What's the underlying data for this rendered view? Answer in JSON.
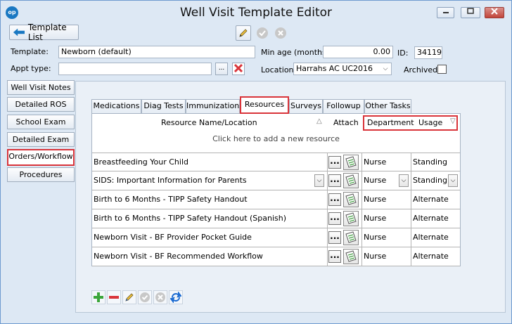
{
  "window": {
    "title": "Well Visit Template Editor",
    "logo_text": "op",
    "controls": [
      "minimize",
      "maximize",
      "close"
    ]
  },
  "toolbar": {
    "template_list_label": "Template List",
    "icons": [
      "edit-icon",
      "accept-icon",
      "cancel-icon"
    ]
  },
  "header": {
    "template_label": "Template:",
    "template_value": "Newborn (default)",
    "appt_type_label": "Appt type:",
    "appt_type_value": "",
    "browse_label": "...",
    "min_age_label": "Min age (months):",
    "min_age_value": "0.00",
    "id_label": "ID:",
    "id_value": "34119",
    "location_label": "Location:",
    "location_value": "Harrahs AC UC2016",
    "archived_label": "Archived:",
    "archived_checked": false
  },
  "sidebar": {
    "items": [
      {
        "label": "Well Visit Notes",
        "active": false
      },
      {
        "label": "Detailed ROS",
        "active": false
      },
      {
        "label": "School Exam",
        "active": false
      },
      {
        "label": "Detailed Exam",
        "active": false
      },
      {
        "label": "Orders/Workflow",
        "active": true
      },
      {
        "label": "Procedures",
        "active": false
      }
    ]
  },
  "tabs": [
    {
      "label": "Medications"
    },
    {
      "label": "Diag Tests"
    },
    {
      "label": "Immunizations"
    },
    {
      "label": "Resources",
      "active": true
    },
    {
      "label": "Surveys"
    },
    {
      "label": "Followup"
    },
    {
      "label": "Other Tasks"
    }
  ],
  "grid": {
    "columns": {
      "name": "Resource Name/Location",
      "attach": "Attach",
      "department": "Department",
      "usage": "Usage"
    },
    "add_row_text": "Click here to add a new resource",
    "more_button": "...",
    "rows": [
      {
        "name": "Breastfeeding Your Child",
        "department": "Nurse",
        "usage": "Standing"
      },
      {
        "name": "SIDS: Important Information for Parents",
        "department": "Nurse",
        "usage": "Standing"
      },
      {
        "name": "Birth to 6 Months - TIPP Safety Handout",
        "department": "Nurse",
        "usage": "Alternate"
      },
      {
        "name": "Birth to 6 Months - TIPP Safety Handout (Spanish)",
        "department": "Nurse",
        "usage": "Alternate"
      },
      {
        "name": "Newborn Visit - BF Provider Pocket Guide",
        "department": "Nurse",
        "usage": "Alternate"
      },
      {
        "name": "Newborn Visit - BF Recommended Workflow",
        "department": "Nurse",
        "usage": "Alternate"
      }
    ]
  },
  "bottom_toolbar": {
    "icons": [
      "add-icon",
      "remove-icon",
      "edit-icon",
      "accept-icon",
      "cancel-icon",
      "refresh-icon"
    ]
  },
  "colors": {
    "window_bg": "#dde8f4",
    "highlight": "#d9343a",
    "accent": "#1a78c2"
  }
}
